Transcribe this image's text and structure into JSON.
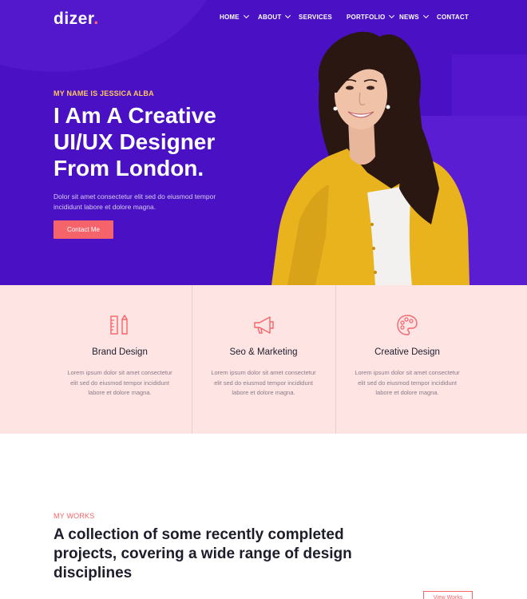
{
  "brand": {
    "name": "dizer",
    "dot": ".",
    "accent_color": "#ff6f61"
  },
  "nav": {
    "items": [
      {
        "label": "HOME",
        "dropdown": true
      },
      {
        "label": "ABOUT",
        "dropdown": true
      },
      {
        "label": "SERVICES",
        "dropdown": false
      },
      {
        "label": "PORTFOLIO",
        "dropdown": true
      },
      {
        "label": "NEWS",
        "dropdown": true
      },
      {
        "label": "CONTACT",
        "dropdown": false
      }
    ]
  },
  "hero": {
    "eyebrow": "MY NAME IS JESSICA ALBA",
    "headline": "I Am A Creative UI/UX Designer From London.",
    "lead": "Dolor sit amet consectetur elit sed do eiusmod tempor incididunt labore et dolore magna.",
    "cta_label": "Contact Me",
    "bg_color": "#4a10c4",
    "eyebrow_color": "#ffc75f",
    "cta_color": "#f5646a"
  },
  "services": {
    "bg_color": "#ffe4e4",
    "items": [
      {
        "icon": "ruler-pencil-icon",
        "title": "Brand Design",
        "text": "Lorem ipsum dolor sit amet consectetur elit sed do eiusmod tempor incididunt labore et dolore magna."
      },
      {
        "icon": "megaphone-icon",
        "title": "Seo & Marketing",
        "text": "Lorem ipsum dolor sit amet consectetur elit sed do eiusmod tempor incididunt labore et dolore magna."
      },
      {
        "icon": "palette-icon",
        "title": "Creative Design",
        "text": "Lorem ipsum dolor sit amet consectetur elit sed do eiusmod tempor incididunt labore et dolore magna."
      }
    ]
  },
  "works": {
    "eyebrow": "MY WORKS",
    "title": "A collection of some recently completed projects, covering a wide range of design disciplines",
    "view_all_label": "View Works"
  }
}
